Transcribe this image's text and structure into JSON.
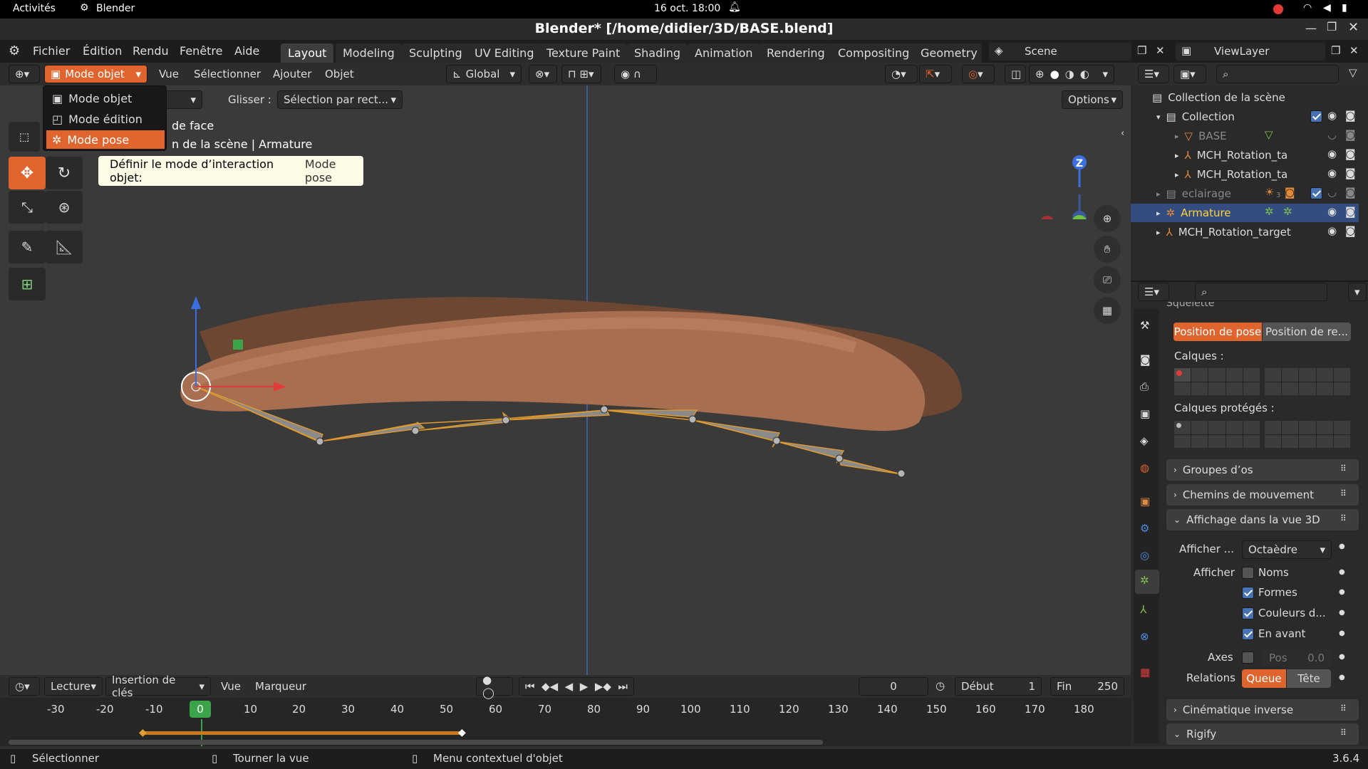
{
  "gnome": {
    "activities": "Activités",
    "app": "Blender",
    "clock": "16 oct.  18:00"
  },
  "window": {
    "title": "Blender* [/home/didier/3D/BASE.blend]"
  },
  "menu": {
    "items": [
      "Fichier",
      "Édition",
      "Rendu",
      "Fenêtre",
      "Aide"
    ]
  },
  "workspaces": [
    "Layout",
    "Modeling",
    "Sculpting",
    "UV Editing",
    "Texture Paint",
    "Shading",
    "Animation",
    "Rendering",
    "Compositing",
    "Geometry N"
  ],
  "scene": {
    "label": "Scene",
    "view_layer": "ViewLayer"
  },
  "viewport_header": {
    "mode": "Mode objet",
    "menus": [
      "Vue",
      "Sélectionner",
      "Ajouter",
      "Objet"
    ],
    "orientation": "Global",
    "options": "Options",
    "drag_label": "Glisser :",
    "drag_value": "Sélection par rect..."
  },
  "overlay_text": {
    "line1": "de face",
    "line2": "n de la scène | Armature"
  },
  "mode_menu": {
    "items": [
      "Mode objet",
      "Mode édition",
      "Mode pose"
    ],
    "selected": "Mode pose"
  },
  "tooltip": {
    "text": "Définir le mode d’interaction objet:",
    "value": "Mode pose"
  },
  "gizmo": {
    "z": "Z",
    "y": "Y",
    "x": "X"
  },
  "outliner": {
    "root": "Collection de la scène",
    "rows": [
      {
        "label": "Collection"
      },
      {
        "label": "BASE"
      },
      {
        "label": "MCH_Rotation_ta"
      },
      {
        "label": "MCH_Rotation_ta"
      },
      {
        "label": "eclairage"
      },
      {
        "label": "Armature"
      },
      {
        "label": "MCH_Rotation_target"
      }
    ],
    "lamp_count": "3"
  },
  "properties": {
    "cut_header": "Squelette",
    "pose_position": "Position de pose",
    "rest_position": "Position de re...",
    "layers_label": "Calques :",
    "protected_layers_label": "Calques protégés :",
    "sections": [
      "Groupes d’os",
      "Chemins de mouvement",
      "Affichage dans la vue 3D",
      "Cinématique inverse",
      "Rigify"
    ],
    "display_as_label": "Afficher ...",
    "display_as_value": "Octaèdre",
    "show_label": "Afficher",
    "checks": [
      {
        "label": "Noms",
        "checked": false
      },
      {
        "label": "Formes",
        "checked": true
      },
      {
        "label": "Couleurs d...",
        "checked": true
      },
      {
        "label": "En avant",
        "checked": true
      }
    ],
    "axes_label": "Axes",
    "pos_label": "Pos",
    "pos_value": "0.0",
    "relations_label": "Relations",
    "relations_options": [
      "Queue",
      "Tête"
    ],
    "relations_selected": "Queue"
  },
  "timeline": {
    "playback": "Lecture",
    "keying": "Insertion de clés",
    "view": "Vue",
    "marker": "Marqueur",
    "current_frame": "0",
    "start_label": "Début",
    "start": "1",
    "end_label": "Fin",
    "end": "250",
    "ticks": [
      "-30",
      "-20",
      "-10",
      "0",
      "10",
      "20",
      "30",
      "40",
      "50",
      "60",
      "70",
      "80",
      "90",
      "100",
      "110",
      "120",
      "130",
      "140",
      "150",
      "160",
      "170",
      "180"
    ]
  },
  "status": {
    "select": "Sélectionner",
    "rotate": "Tourner la vue",
    "context": "Menu contextuel d'objet",
    "version": "3.6.4"
  }
}
